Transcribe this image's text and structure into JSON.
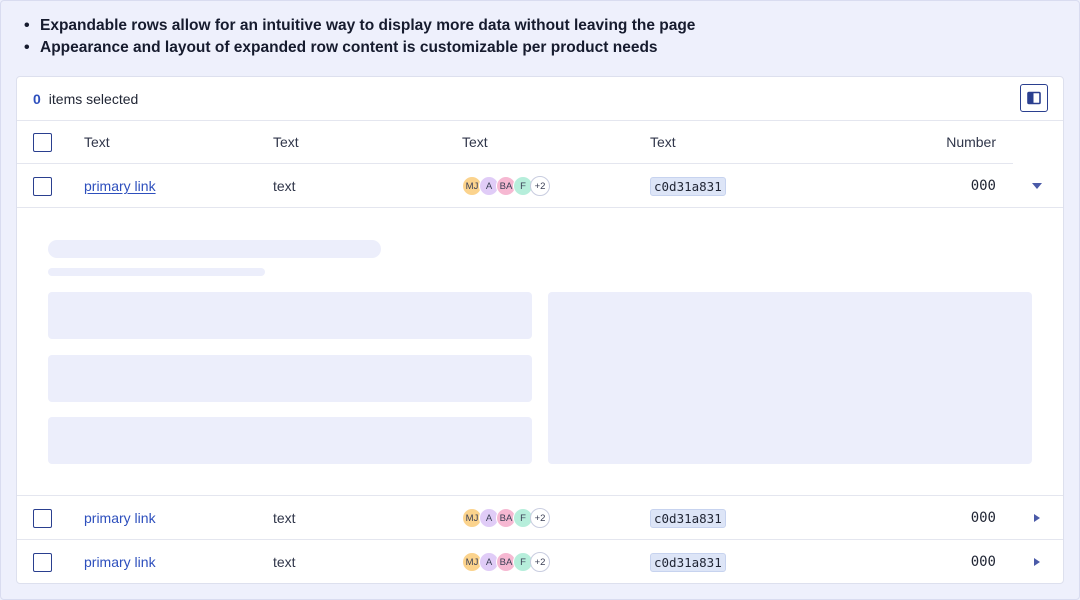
{
  "bullets": [
    "Expandable rows allow for an intuitive way to display more data without leaving the page",
    "Appearance and layout of expanded row content is customizable per product needs"
  ],
  "bullet_glyph": "•",
  "selection": {
    "count": "0",
    "label": "items selected"
  },
  "columns": [
    "Text",
    "Text",
    "Text",
    "Text",
    "Number"
  ],
  "avatar_colors": [
    "#fbd38d",
    "#e0ccf7",
    "#f6b8d2",
    "#b6eedb"
  ],
  "rows": [
    {
      "link": "primary link",
      "text": "text",
      "avatars": [
        "MJ",
        "A",
        "BA",
        "F"
      ],
      "more": "+2",
      "code": "c0d31a831",
      "number": "000",
      "expanded": true
    },
    {
      "link": "primary link",
      "text": "text",
      "avatars": [
        "MJ",
        "A",
        "BA",
        "F"
      ],
      "more": "+2",
      "code": "c0d31a831",
      "number": "000",
      "expanded": false
    },
    {
      "link": "primary link",
      "text": "text",
      "avatars": [
        "MJ",
        "A",
        "BA",
        "F"
      ],
      "more": "+2",
      "code": "c0d31a831",
      "number": "000",
      "expanded": false
    }
  ],
  "icons": {
    "panel": "side-panel-icon",
    "expanded_toggle": "caret-down-icon",
    "collapsed_toggle": "caret-right-icon"
  }
}
